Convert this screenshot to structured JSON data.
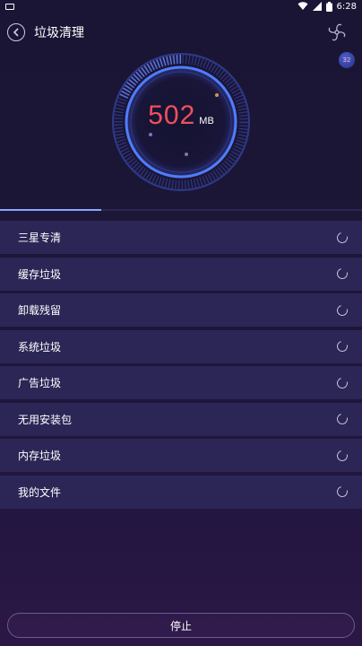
{
  "status_bar": {
    "time": "6:28",
    "wifi_icon": "wifi-icon",
    "signal_icon": "signal-icon",
    "battery_icon": "battery-icon"
  },
  "header": {
    "title": "垃圾清理",
    "back_icon": "back-arrow-icon",
    "fan_icon": "fan-icon"
  },
  "badge": {
    "value": "32"
  },
  "gauge": {
    "value": "502",
    "unit": "MB"
  },
  "scan_progress": 0.28,
  "items": [
    {
      "label": "三星专清"
    },
    {
      "label": "缓存垃圾"
    },
    {
      "label": "卸载残留"
    },
    {
      "label": "系统垃圾"
    },
    {
      "label": "广告垃圾"
    },
    {
      "label": "无用安装包"
    },
    {
      "label": "内存垃圾"
    },
    {
      "label": "我的文件"
    }
  ],
  "footer": {
    "stop_label": "停止"
  },
  "colors": {
    "accent": "#f0505e",
    "ring": "#4f7dff",
    "row_bg": "#2b2656"
  }
}
